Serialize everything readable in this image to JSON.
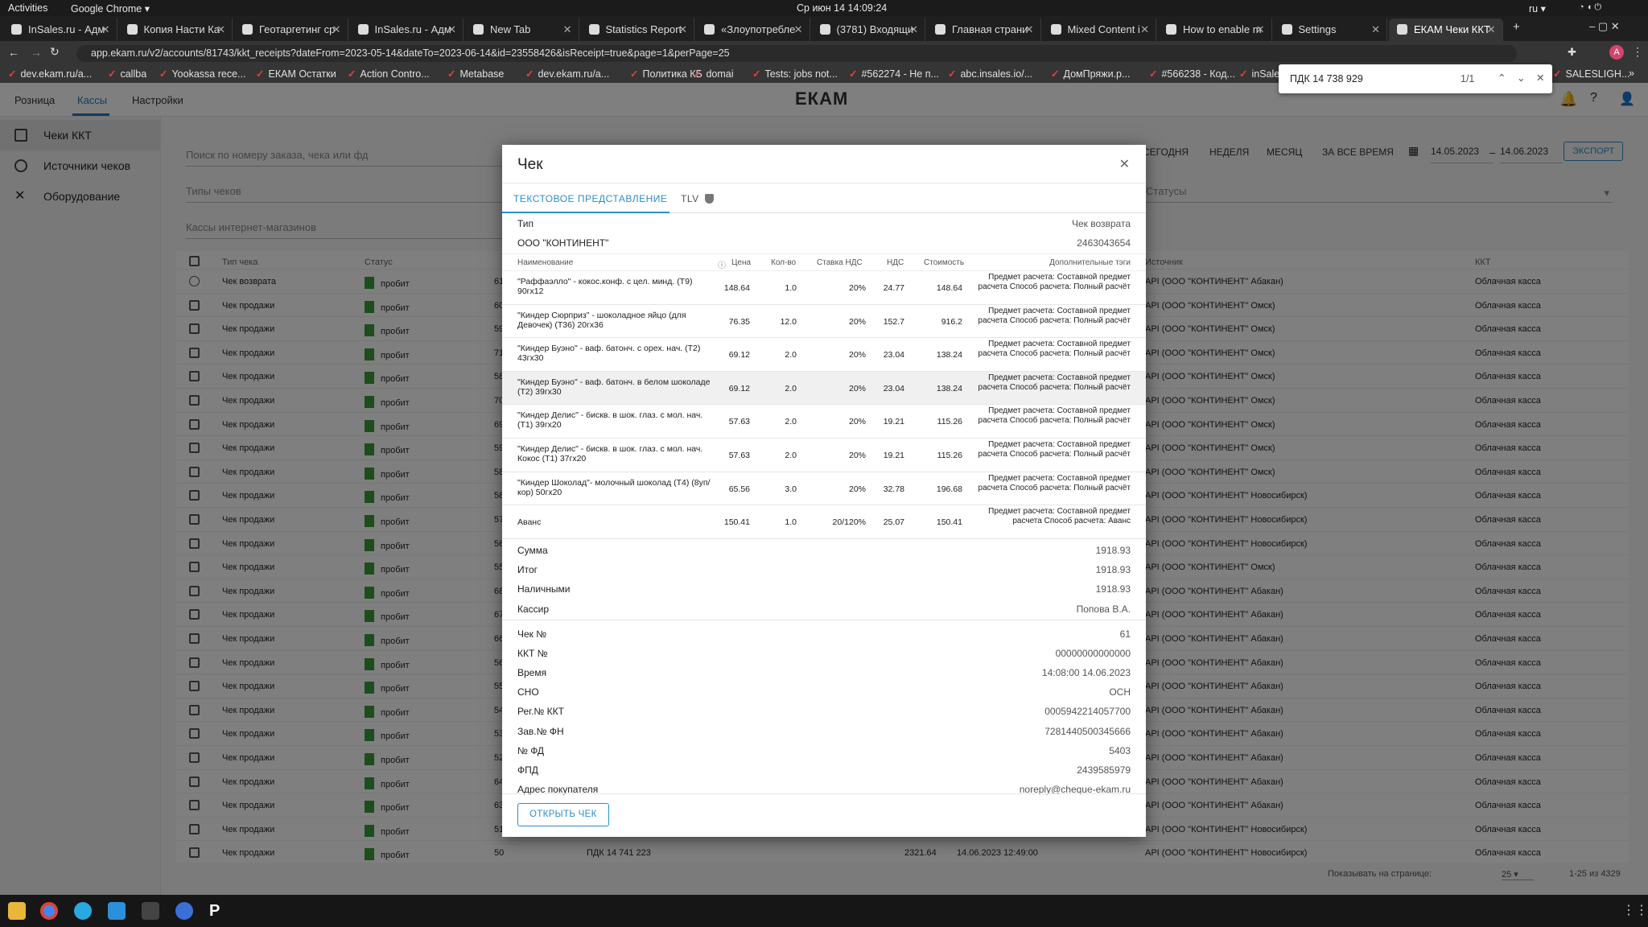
{
  "system": {
    "activities": "Activities",
    "app_menu": "Google Chrome ▾",
    "clock": "Ср июн 14  14:09:24",
    "lang": "ru ▾"
  },
  "tabs": [
    {
      "label": "InSales.ru - Адм"
    },
    {
      "label": "Копия Насти Ка"
    },
    {
      "label": "Геотаргетинг ср"
    },
    {
      "label": "InSales.ru - Адм"
    },
    {
      "label": "New Tab"
    },
    {
      "label": "Statistics Report"
    },
    {
      "label": "«Злоупотребле"
    },
    {
      "label": "(3781) Входящи"
    },
    {
      "label": "Главная страни"
    },
    {
      "label": "Mixed Content i"
    },
    {
      "label": "How to enable m"
    },
    {
      "label": "Settings"
    },
    {
      "label": "ЕКАМ Чеки ККТ"
    }
  ],
  "address": "app.ekam.ru/v2/accounts/81743/kkt_receipts?dateFrom=2023-05-14&dateTo=2023-06-14&id=23558426&isReceipt=true&page=1&perPage=25",
  "bookmarks": [
    "dev.ekam.ru/a...",
    "callba",
    "Yookassa rece...",
    "ЕКАМ Остатки",
    "Action Contro...",
    "Metabase",
    "dev.ekam.ru/a...",
    "Политика КБ",
    "domai",
    "Tests: jobs not...",
    "#562274 - Не п...",
    "abc.insales.io/...",
    "ДомПряжи.р...",
    "#566238 - Код...",
    "inSale",
    "SALESLIGH..."
  ],
  "find": {
    "query": "ПДК 14 738 929",
    "count": "1/1"
  },
  "app": {
    "nav": [
      "Розница",
      "Кассы",
      "Настройки"
    ],
    "logo": "ЕКАМ",
    "sidebar": [
      "Чеки ККТ",
      "Источники чеков",
      "Оборудование"
    ],
    "search_placeholder": "Поиск по номеру заказа, чека или фд",
    "types_label": "Типы чеков",
    "shops_label": "Кассы интернет-магазинов",
    "status_label": "Статусы",
    "periods": [
      "СЕГОДНЯ",
      "НЕДЕЛЯ",
      "МЕСЯЦ",
      "ЗА ВСЕ ВРЕМЯ"
    ],
    "date_from": "14.05.2023",
    "date_to": "14.06.2023",
    "export": "ЭКСПОРТ",
    "columns": {
      "type": "Тип чека",
      "status": "Статус",
      "source": "Источник",
      "kkt": "ККТ"
    },
    "rows": [
      {
        "type": "Чек возврата",
        "status": "пробит",
        "num": "61",
        "source": "API (ООО \"КОНТИНЕНТ\" Абакан)",
        "kkt": "Облачная касса"
      },
      {
        "type": "Чек продажи",
        "status": "пробит",
        "num": "60",
        "source": "API (ООО \"КОНТИНЕНТ\" Омск)",
        "kkt": "Облачная касса"
      },
      {
        "type": "Чек продажи",
        "status": "пробит",
        "num": "59",
        "source": "API (ООО \"КОНТИНЕНТ\" Омск)",
        "kkt": "Облачная касса"
      },
      {
        "type": "Чек продажи",
        "status": "пробит",
        "num": "71",
        "source": "API (ООО \"КОНТИНЕНТ\" Омск)",
        "kkt": "Облачная касса"
      },
      {
        "type": "Чек продажи",
        "status": "пробит",
        "num": "58",
        "source": "API (ООО \"КОНТИНЕНТ\" Омск)",
        "kkt": "Облачная касса"
      },
      {
        "type": "Чек продажи",
        "status": "пробит",
        "num": "70",
        "source": "API (ООО \"КОНТИНЕНТ\" Омск)",
        "kkt": "Облачная касса"
      },
      {
        "type": "Чек продажи",
        "status": "пробит",
        "num": "69",
        "source": "API (ООО \"КОНТИНЕНТ\" Омск)",
        "kkt": "Облачная касса"
      },
      {
        "type": "Чек продажи",
        "status": "пробит",
        "num": "59",
        "source": "API (ООО \"КОНТИНЕНТ\" Омск)",
        "kkt": "Облачная касса"
      },
      {
        "type": "Чек продажи",
        "status": "пробит",
        "num": "58",
        "source": "API (ООО \"КОНТИНЕНТ\" Омск)",
        "kkt": "Облачная касса"
      },
      {
        "type": "Чек продажи",
        "status": "пробит",
        "num": "58",
        "source": "API (ООО \"КОНТИНЕНТ\" Новосибирск)",
        "kkt": "Облачная касса"
      },
      {
        "type": "Чек продажи",
        "status": "пробит",
        "num": "57",
        "source": "API (ООО \"КОНТИНЕНТ\" Новосибирск)",
        "kkt": "Облачная касса"
      },
      {
        "type": "Чек продажи",
        "status": "пробит",
        "num": "56",
        "source": "API (ООО \"КОНТИНЕНТ\" Новосибирск)",
        "kkt": "Облачная касса"
      },
      {
        "type": "Чек продажи",
        "status": "пробит",
        "num": "55",
        "source": "API (ООО \"КОНТИНЕНТ\" Омск)",
        "kkt": "Облачная касса"
      },
      {
        "type": "Чек продажи",
        "status": "пробит",
        "num": "68",
        "source": "API (ООО \"КОНТИНЕНТ\" Абакан)",
        "kkt": "Облачная касса"
      },
      {
        "type": "Чек продажи",
        "status": "пробит",
        "num": "67",
        "source": "API (ООО \"КОНТИНЕНТ\" Абакан)",
        "kkt": "Облачная касса"
      },
      {
        "type": "Чек продажи",
        "status": "пробит",
        "num": "66",
        "source": "API (ООО \"КОНТИНЕНТ\" Абакан)",
        "kkt": "Облачная касса"
      },
      {
        "type": "Чек продажи",
        "status": "пробит",
        "num": "56",
        "source": "API (ООО \"КОНТИНЕНТ\" Абакан)",
        "kkt": "Облачная касса"
      },
      {
        "type": "Чек продажи",
        "status": "пробит",
        "num": "55",
        "source": "API (ООО \"КОНТИНЕНТ\" Абакан)",
        "kkt": "Облачная касса"
      },
      {
        "type": "Чек продажи",
        "status": "пробит",
        "num": "54",
        "source": "API (ООО \"КОНТИНЕНТ\" Абакан)",
        "kkt": "Облачная касса"
      },
      {
        "type": "Чек продажи",
        "status": "пробит",
        "num": "53",
        "source": "API (ООО \"КОНТИНЕНТ\" Абакан)",
        "kkt": "Облачная касса"
      },
      {
        "type": "Чек продажи",
        "status": "пробит",
        "num": "52",
        "source": "API (ООО \"КОНТИНЕНТ\" Абакан)",
        "kkt": "Облачная касса"
      },
      {
        "type": "Чек продажи",
        "status": "пробит",
        "num": "64",
        "source": "API (ООО \"КОНТИНЕНТ\" Абакан)",
        "kkt": "Облачная касса"
      },
      {
        "type": "Чек продажи",
        "status": "пробит",
        "num": "63",
        "source": "API (ООО \"КОНТИНЕНТ\" Абакан)",
        "kkt": "Облачная касса"
      },
      {
        "type": "Чек продажи",
        "status": "пробит",
        "num": "51",
        "source": "API (ООО \"КОНТИНЕНТ\" Новосибирск)",
        "kkt": "Облачная касса"
      },
      {
        "type": "Чек продажи",
        "status": "пробит",
        "num": "50",
        "order": "ПДК 14 741 223",
        "sum": "2321.64",
        "date": "14.06.2023 12:49:00",
        "source": "API (ООО \"КОНТИНЕНТ\" Новосибирск)",
        "kkt": "Облачная касса"
      }
    ],
    "pager": {
      "label": "Показывать на странице:",
      "per_page": "25",
      "range": "1-25 из 4329"
    }
  },
  "modal": {
    "title": "Чек",
    "tab_text": "ТЕКСТОВОЕ ПРЕДСТАВЛЕНИЕ",
    "tab_tlv": "TLV",
    "type_label": "Тип",
    "type_value": "Чек возврата",
    "org": "ООО \"КОНТИНЕНТ\"",
    "inn": "2463043654",
    "headers": {
      "name": "Наименование",
      "price": "Цена",
      "qty": "Кол-во",
      "vat_rate": "Ставка НДС",
      "vat": "НДС",
      "cost": "Стоимость",
      "tags": "Дополнительные тэги"
    },
    "items": [
      {
        "name": "\"Раффаэлло\" - кокос.конф. с цел. минд. (Т9) 90гх12",
        "price": "148.64",
        "qty": "1.0",
        "vat_rate": "20%",
        "vat": "24.77",
        "cost": "148.64",
        "tags": "Предмет расчета: Составной предмет расчета Способ расчета: Полный расчёт"
      },
      {
        "name": "\"Киндер Сюрприз\" - шоколадное яйцо (для Девочек) (Т36) 20гх36",
        "price": "76.35",
        "qty": "12.0",
        "vat_rate": "20%",
        "vat": "152.7",
        "cost": "916.2",
        "tags": "Предмет расчета: Составной предмет расчета Способ расчета: Полный расчёт"
      },
      {
        "name": "\"Киндер Буэно\" - ваф. батонч. с орех. нач. (Т2) 43гх30",
        "price": "69.12",
        "qty": "2.0",
        "vat_rate": "20%",
        "vat": "23.04",
        "cost": "138.24",
        "tags": "Предмет расчета: Составной предмет расчета Способ расчета: Полный расчёт"
      },
      {
        "name": "\"Киндер Буэно\" - ваф. батонч. в белом шоколаде (Т2) 39гх30",
        "price": "69.12",
        "qty": "2.0",
        "vat_rate": "20%",
        "vat": "23.04",
        "cost": "138.24",
        "tags": "Предмет расчета: Составной предмет расчета Способ расчета: Полный расчёт"
      },
      {
        "name": "\"Киндер Делис\" - бискв. в шок. глаз. с мол. нач. (Т1) 39гх20",
        "price": "57.63",
        "qty": "2.0",
        "vat_rate": "20%",
        "vat": "19.21",
        "cost": "115.26",
        "tags": "Предмет расчета: Составной предмет расчета Способ расчета: Полный расчёт"
      },
      {
        "name": "\"Киндер Делис\" - бискв. в шок. глаз. с мол. нач. Кокос (Т1) 37гх20",
        "price": "57.63",
        "qty": "2.0",
        "vat_rate": "20%",
        "vat": "19.21",
        "cost": "115.26",
        "tags": "Предмет расчета: Составной предмет расчета Способ расчета: Полный расчёт"
      },
      {
        "name": "\"Киндер Шоколад\"- молочный шоколад (Т4) (8уп/кор) 50гх20",
        "price": "65.56",
        "qty": "3.0",
        "vat_rate": "20%",
        "vat": "32.78",
        "cost": "196.68",
        "tags": "Предмет расчета: Составной предмет расчета Способ расчета: Полный расчёт"
      },
      {
        "name": "Аванс",
        "price": "150.41",
        "qty": "1.0",
        "vat_rate": "20/120%",
        "vat": "25.07",
        "cost": "150.41",
        "tags": "Предмет расчета: Составной предмет расчета Способ расчета: Аванс"
      }
    ],
    "totals": [
      {
        "k": "Сумма",
        "v": "1918.93"
      },
      {
        "k": "Итог",
        "v": "1918.93"
      },
      {
        "k": "Наличными",
        "v": "1918.93"
      },
      {
        "k": "Кассир",
        "v": "Попова В.А."
      }
    ],
    "details": [
      {
        "k": "Чек №",
        "v": "61"
      },
      {
        "k": "ККТ №",
        "v": "00000000000000"
      },
      {
        "k": "Время",
        "v": "14:08:00 14.06.2023"
      },
      {
        "k": "СНО",
        "v": "ОСН"
      },
      {
        "k": "Рег.№ ККТ",
        "v": "0005942214057700"
      },
      {
        "k": "Зав.№ ФН",
        "v": "7281440500345666"
      },
      {
        "k": "№ ФД",
        "v": "5403"
      },
      {
        "k": "ФПД",
        "v": "2439585979"
      },
      {
        "k": "Адрес покупателя",
        "v": "noreply@cheque-ekam.ru"
      }
    ],
    "open_button": "ОТКРЫТЬ ЧЕК"
  }
}
